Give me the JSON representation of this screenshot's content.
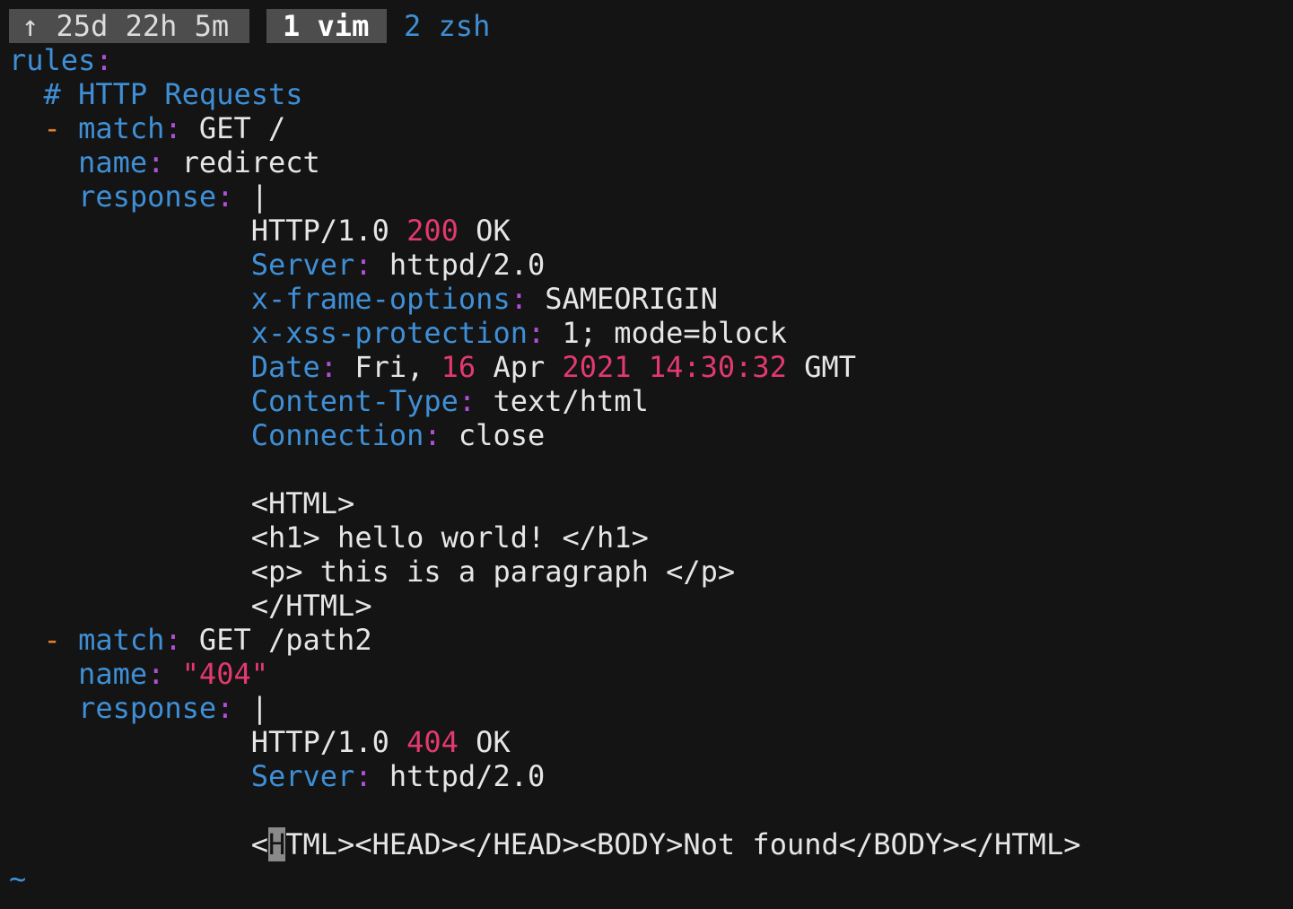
{
  "statusbar": {
    "uptime_arrow": "↑",
    "uptime": "25d 22h 5m",
    "active_window": "1 vim",
    "inactive_window": "2 zsh"
  },
  "editor": {
    "rules_key": "rules",
    "comment": "# HTTP Requests",
    "rule1": {
      "dash": "-",
      "match_key": "match",
      "match_value": "GET /",
      "name_key": "name",
      "name_value": "redirect",
      "response_key": "response",
      "response_marker": "|",
      "status_proto": "HTTP/1.0",
      "status_code": "200",
      "status_text": "OK",
      "headers": [
        {
          "key": "Server",
          "value": "httpd/2.0"
        },
        {
          "key": "x-frame-options",
          "value": "SAMEORIGIN"
        },
        {
          "key": "x-xss-protection",
          "value": "1; mode=block"
        }
      ],
      "date_key": "Date",
      "date_day": "Fri,",
      "date_dom": "16",
      "date_month": "Apr",
      "date_year": "2021",
      "date_time": "14:30:32",
      "date_tz": "GMT",
      "headers2": [
        {
          "key": "Content-Type",
          "value": "text/html"
        },
        {
          "key": "Connection",
          "value": "close"
        }
      ],
      "body": [
        "<HTML>",
        "<h1> hello world! </h1>",
        "<p> this is a paragraph </p>",
        "</HTML>"
      ]
    },
    "rule2": {
      "dash": "-",
      "match_key": "match",
      "match_value": "GET /path2",
      "name_key": "name",
      "name_value": "\"404\"",
      "response_key": "response",
      "response_marker": "|",
      "status_proto": "HTTP/1.0",
      "status_code": "404",
      "status_text": "OK",
      "server_key": "Server",
      "server_value": "httpd/2.0",
      "body_before_cursor": "<",
      "body_cursor_char": "H",
      "body_after_cursor": "TML><HEAD></HEAD><BODY>Not found</BODY></HTML>"
    },
    "empty_line_marker": "~"
  }
}
